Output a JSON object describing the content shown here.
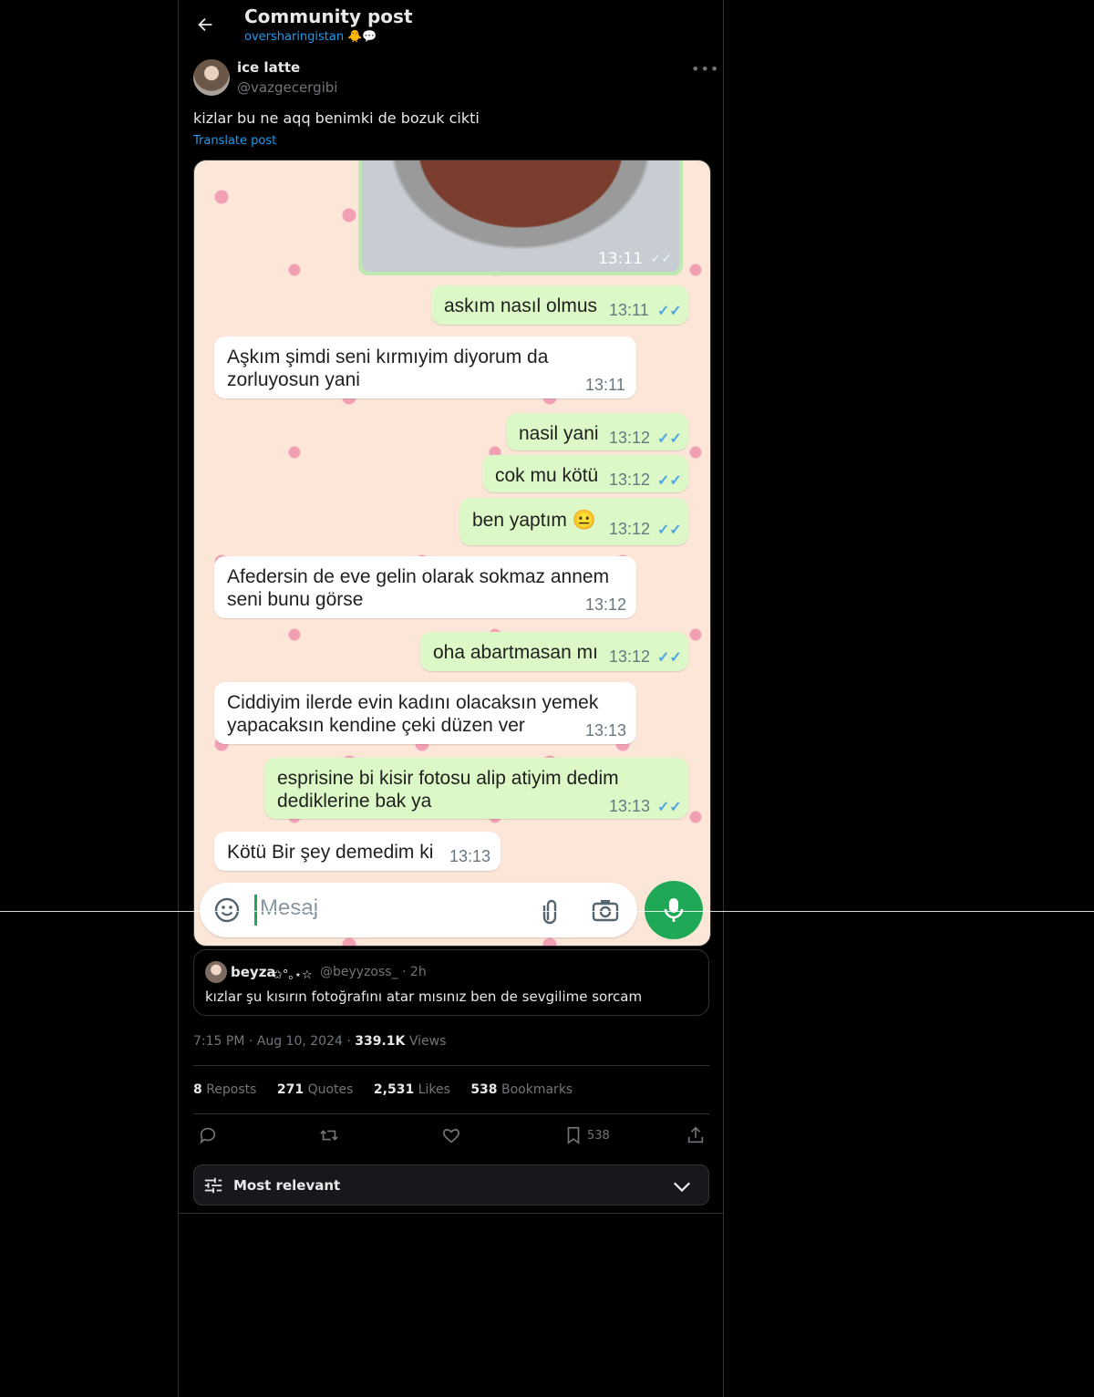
{
  "header": {
    "title": "Community post",
    "community": "oversharingistan 🐥💬"
  },
  "post": {
    "author_name": "ice latte",
    "author_handle": "@vazgecergibi",
    "text": "kizlar bu ne aqq benimki de bozuk cikti",
    "translate_label": "Translate post",
    "timestamp": "7:15 PM · Aug 10, 2024 · ",
    "views_count": "339.1K",
    "views_label": " Views"
  },
  "chat": {
    "food_time": "13:11",
    "messages": [
      {
        "text": "askım nasıl olmus",
        "time": "13:11"
      },
      {
        "text_1": "Aşkım şimdi seni kırmıyim diyorum da",
        "text_2": "zorluyosun yani",
        "time": "13:11"
      },
      {
        "text": "nasil yani",
        "time": "13:12"
      },
      {
        "text": "cok mu kötü",
        "time": "13:12"
      },
      {
        "text": "ben yaptım 😐",
        "time": "13:12"
      },
      {
        "text_1": "Afedersin de eve gelin olarak sokmaz annem",
        "text_2": "seni bunu görse",
        "time": "13:12"
      },
      {
        "text": "oha abartmasan mı",
        "time": "13:12"
      },
      {
        "text_1": "Ciddiyim ilerde evin kadını olacaksın yemek",
        "text_2": "yapacaksın kendine çeki düzen ver",
        "time": "13:13"
      },
      {
        "text_1": "esprisine bi kisir fotosu alip atiyim dedim",
        "text_2": "dediklerine bak ya",
        "time": "13:13"
      },
      {
        "text": "Kötü Bir şey demedim ki",
        "time": "13:13"
      }
    ],
    "input_placeholder": "Mesaj"
  },
  "quote": {
    "name": "beyza",
    "decoration": "✩°｡⋆☆",
    "handle": "@beyyzoss_ · 2h",
    "text": "kızlar şu kısırın fotoğrafını atar mısınız ben de sevgilime sorcam"
  },
  "stats": {
    "reposts_count": "8",
    "reposts_label": " Reposts",
    "quotes_count": "271",
    "quotes_label": " Quotes",
    "likes_count": "2,531",
    "likes_label": " Likes",
    "bookmarks_count": "538",
    "bookmarks_label": " Bookmarks"
  },
  "actions": {
    "bookmark_count": "538"
  },
  "sort": {
    "label": "Most relevant"
  },
  "colors": {
    "accent": "#1d9bf0",
    "outgoing_bubble": "#dcf8c6",
    "whatsapp_green": "#1fa855"
  }
}
